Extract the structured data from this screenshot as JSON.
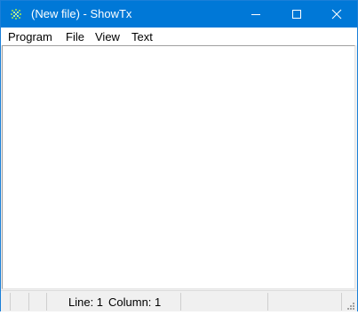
{
  "window": {
    "title": "(New file) - ShowTx",
    "icon": "showtx-app-icon",
    "title_bar_color": "#0078d7"
  },
  "caption_buttons": {
    "minimize_icon": "minimize-icon",
    "maximize_icon": "maximize-icon",
    "close_icon": "close-icon"
  },
  "menu": {
    "items": [
      {
        "label": "Program"
      },
      {
        "label": "File"
      },
      {
        "label": "View"
      },
      {
        "label": "Text"
      }
    ]
  },
  "editor": {
    "content": ""
  },
  "status": {
    "line": "Line: 1",
    "column": "Column: 1"
  }
}
